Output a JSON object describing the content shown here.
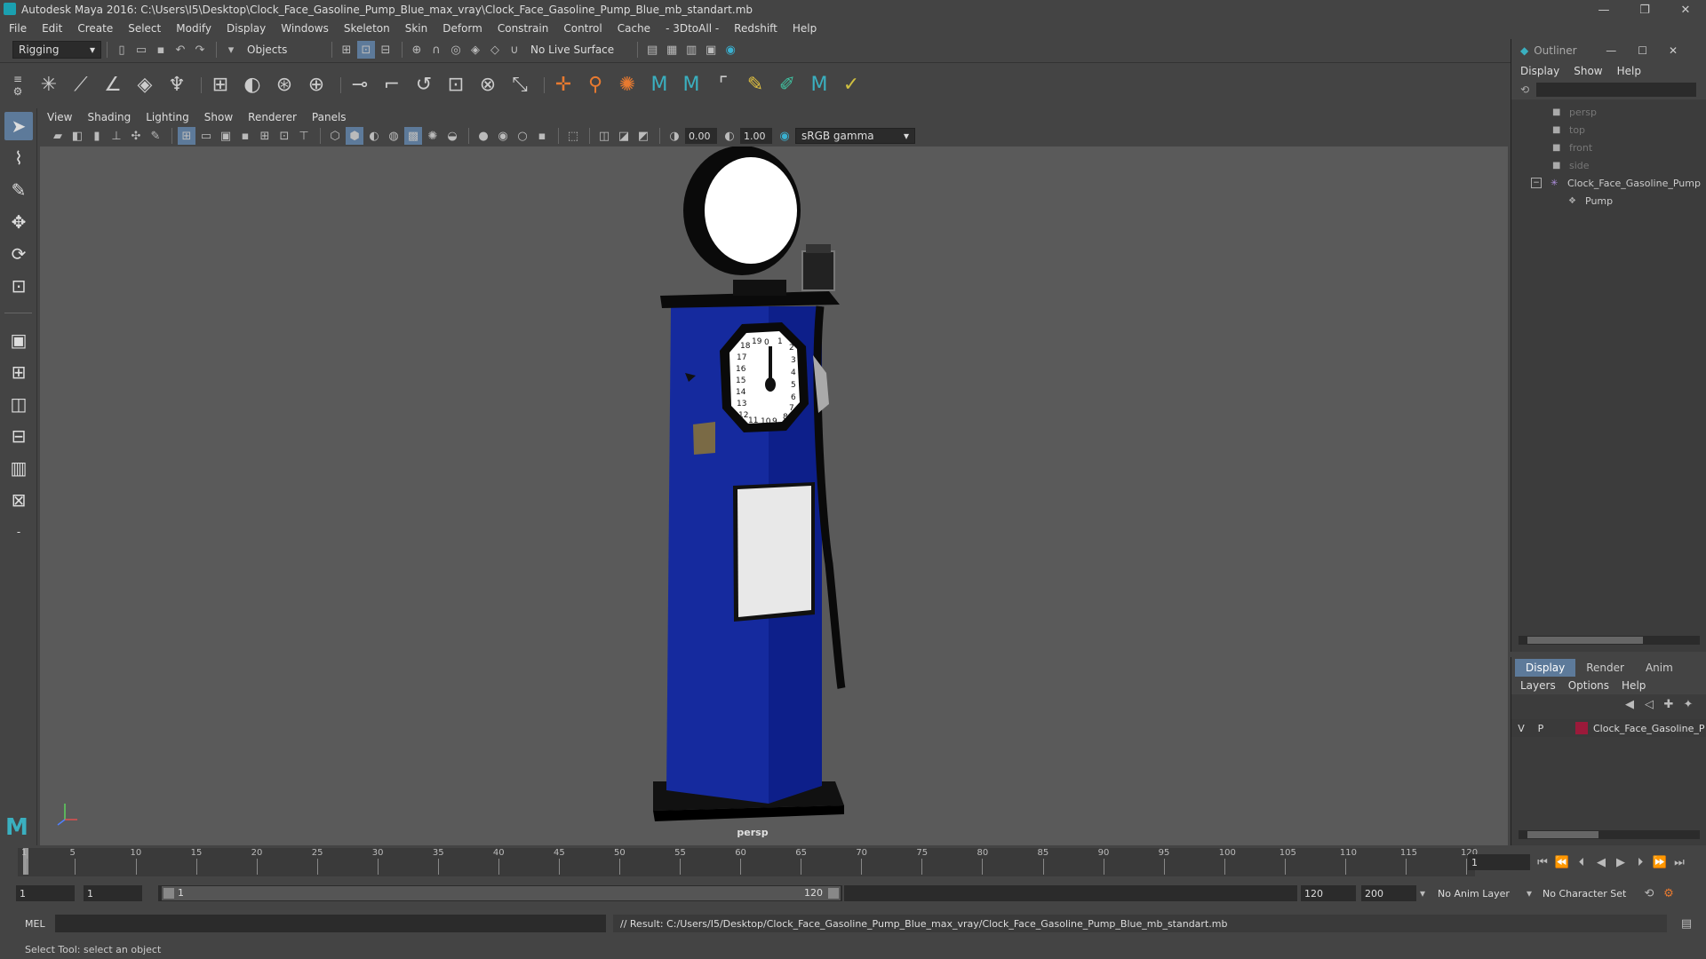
{
  "window": {
    "title": "Autodesk Maya 2016: C:\\Users\\I5\\Desktop\\Clock_Face_Gasoline_Pump_Blue_max_vray\\Clock_Face_Gasoline_Pump_Blue_mb_standart.mb",
    "minimize": "—",
    "restore": "❐",
    "close": "✕"
  },
  "menubar": [
    "File",
    "Edit",
    "Create",
    "Select",
    "Modify",
    "Display",
    "Windows",
    "Skeleton",
    "Skin",
    "Deform",
    "Constrain",
    "Control",
    "Cache",
    "- 3DtoAll -",
    "Redshift",
    "Help"
  ],
  "statusline": {
    "mode": "Rigging",
    "selection_mode": "Objects",
    "live_surface": "No Live Surface"
  },
  "panel_menu": [
    "View",
    "Shading",
    "Lighting",
    "Show",
    "Renderer",
    "Panels"
  ],
  "panel_toolbar": {
    "exposure": "0.00",
    "gamma": "1.00",
    "color_space": "sRGB gamma"
  },
  "viewport": {
    "camera": "persp",
    "clock_numbers": [
      "0",
      "1",
      "2",
      "3",
      "4",
      "5",
      "6",
      "7",
      "8",
      "9",
      "10",
      "11",
      "12",
      "13",
      "14",
      "15",
      "16",
      "17",
      "18",
      "19"
    ]
  },
  "outliner": {
    "title": "Outliner",
    "menu": [
      "Display",
      "Show",
      "Help"
    ],
    "nodes": [
      {
        "label": "persp",
        "type": "camera"
      },
      {
        "label": "top",
        "type": "camera"
      },
      {
        "label": "front",
        "type": "camera"
      },
      {
        "label": "side",
        "type": "camera"
      },
      {
        "label": "Clock_Face_Gasoline_Pump",
        "type": "group"
      },
      {
        "label": "Pump",
        "type": "mesh"
      }
    ]
  },
  "layer_editor": {
    "tabs": [
      "Display",
      "Render",
      "Anim"
    ],
    "menu": [
      "Layers",
      "Options",
      "Help"
    ],
    "layer": {
      "v": "V",
      "p": "P",
      "name": "Clock_Face_Gasoline_P",
      "color": "#9b1a3a"
    }
  },
  "timeline": {
    "ticks": [
      "1",
      "5",
      "10",
      "15",
      "20",
      "25",
      "30",
      "35",
      "40",
      "45",
      "50",
      "55",
      "60",
      "65",
      "70",
      "75",
      "80",
      "85",
      "90",
      "95",
      "100",
      "105",
      "110",
      "115",
      "120"
    ],
    "current_frame": "1"
  },
  "range": {
    "start": "1",
    "playback_start": "1",
    "slider_start": "1",
    "slider_end": "120",
    "playback_end": "120",
    "end": "200",
    "anim_layer": "No Anim Layer",
    "character_set": "No Character Set"
  },
  "cmdline": {
    "language": "MEL",
    "result": "// Result: C:/Users/I5/Desktop/Clock_Face_Gasoline_Pump_Blue_max_vray/Clock_Face_Gasoline_Pump_Blue_mb_standart.mb"
  },
  "helpline": "Select Tool: select an object"
}
